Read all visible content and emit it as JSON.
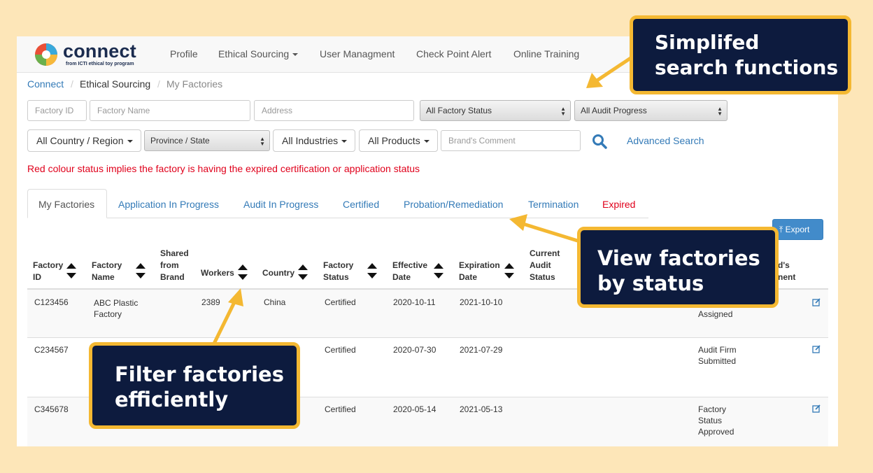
{
  "nav": {
    "logo_word": "connect",
    "logo_sub": "from ICTI ethical toy program",
    "items": [
      "Profile",
      "Ethical Sourcing",
      "User Managment",
      "Check Point Alert",
      "Online Training"
    ]
  },
  "breadcrumb": [
    "Connect",
    "Ethical Sourcing",
    "My Factories"
  ],
  "filters": {
    "factory_id_placeholder": "Factory ID",
    "factory_name_placeholder": "Factory Name",
    "address_placeholder": "Address",
    "factory_status": "All Factory Status",
    "audit_progress": "All Audit Progress",
    "country": "All Country / Region",
    "province": "Province / State",
    "industries": "All Industries",
    "products": "All Products",
    "brand_comment_placeholder": "Brand's Comment",
    "advanced_search": "Advanced Search"
  },
  "red_note": "Red colour status implies the factory is having the expired certification or application status",
  "tabs": {
    "active": "My Factories",
    "items": [
      "Application In Progress",
      "Audit In Progress",
      "Certified",
      "Probation/Remediation",
      "Termination",
      "Expired"
    ],
    "expired_color": "#e0001b"
  },
  "export_label": "Export",
  "table": {
    "headers": {
      "factory_id_1": "Factory",
      "factory_id_2": "ID",
      "factory_name_1": "Factory",
      "factory_name_2": "Name",
      "shared_1": "Shared",
      "shared_2": "from",
      "shared_3": "Brand",
      "workers": "Workers",
      "country": "Country",
      "status_1": "Factory",
      "status_2": "Status",
      "effective_1": "Effective",
      "effective_2": "Date",
      "expiration_1": "Expiration",
      "expiration_2": "Date",
      "audit_1": "Current",
      "audit_2": "Audit",
      "audit_3": "Status",
      "brand_comment_1": "d's",
      "brand_comment_2": "nent"
    },
    "rows": [
      {
        "id": "C123456",
        "name_1": "ABC Plastic",
        "name_2": "Factory",
        "workers": "2389",
        "country": "China",
        "status": "Certified",
        "effective": "2020-10-11",
        "expiration": "2021-10-10",
        "progress_1": "Assigned",
        "progress_2": "",
        "progress_3": ""
      },
      {
        "id": "C234567",
        "name_1": "",
        "name_2": "",
        "workers": "",
        "country": "",
        "status": "Certified",
        "effective": "2020-07-30",
        "expiration": "2021-07-29",
        "progress_1": "Audit Firm",
        "progress_2": "Submitted",
        "progress_3": ""
      },
      {
        "id": "C345678",
        "name_1": "",
        "name_2": "",
        "workers": "",
        "country": "",
        "status": "Certified",
        "effective": "2020-05-14",
        "expiration": "2021-05-13",
        "progress_1": "Factory",
        "progress_2": "Status",
        "progress_3": "Approved"
      }
    ]
  },
  "callouts": {
    "search": "Simplifed\nsearch functions",
    "status": "View factories\nby status",
    "filter": "Filter factories\nefficiently"
  },
  "colors": {
    "background": "#fde6b8",
    "callout_bg": "#0d1b3e",
    "callout_border": "#f4b832",
    "link": "#337ab7"
  }
}
